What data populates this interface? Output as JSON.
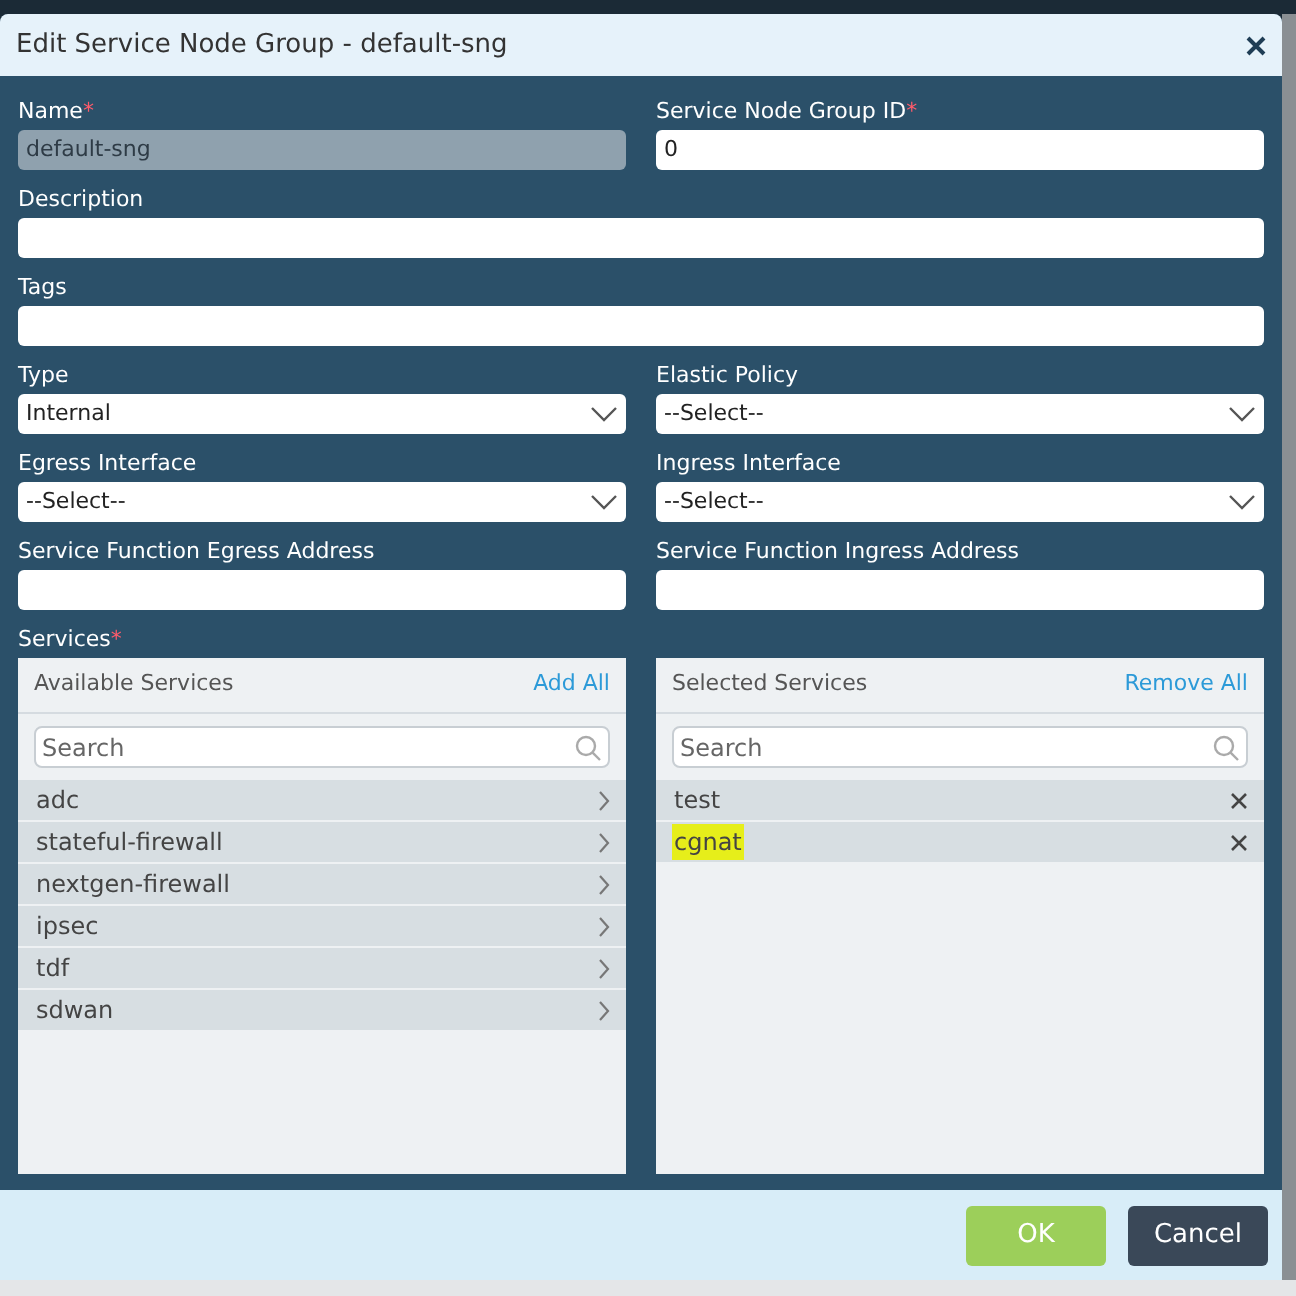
{
  "dialog": {
    "title": "Edit Service Node Group - default-sng"
  },
  "fields": [
    {
      "kind": "text",
      "label": "Name",
      "required_mark": "*",
      "value": "default-sng",
      "disabled": true,
      "wide": false
    },
    {
      "kind": "text",
      "label": "Service Node Group ID",
      "required_mark": "*",
      "value": "0",
      "disabled": false,
      "wide": false
    },
    {
      "kind": "text",
      "label": "Description",
      "disabled": false,
      "wide": true
    },
    {
      "kind": "text",
      "label": "Tags",
      "disabled": false,
      "wide": true
    },
    {
      "kind": "select",
      "label": "Type",
      "value": "Internal",
      "disabled": false,
      "wide": false
    },
    {
      "kind": "select",
      "label": "Elastic Policy",
      "value": "--Select--",
      "disabled": false,
      "wide": false
    },
    {
      "kind": "select",
      "label": "Egress Interface",
      "value": "--Select--",
      "disabled": false,
      "wide": false
    },
    {
      "kind": "select",
      "label": "Ingress Interface",
      "value": "--Select--",
      "disabled": false,
      "wide": false
    },
    {
      "kind": "text",
      "label": "Service Function Egress Address",
      "disabled": false,
      "wide": false
    },
    {
      "kind": "text",
      "label": "Service Function Ingress Address",
      "disabled": false,
      "wide": false
    }
  ],
  "services": {
    "label": "Services",
    "required_mark": "*",
    "available": {
      "title": "Available Services",
      "action": "Add All",
      "placeholder": "Search",
      "items": [
        {
          "name": "adc",
          "highlighted": false
        },
        {
          "name": "stateful-firewall",
          "highlighted": false
        },
        {
          "name": "nextgen-firewall",
          "highlighted": false
        },
        {
          "name": "ipsec",
          "highlighted": false
        },
        {
          "name": "tdf",
          "highlighted": false
        },
        {
          "name": "sdwan",
          "highlighted": false
        }
      ]
    },
    "selected": {
      "title": "Selected Services",
      "action": "Remove All",
      "placeholder": "Search",
      "items": [
        {
          "name": "test",
          "highlighted": false
        },
        {
          "name": "cgnat",
          "highlighted": true
        }
      ]
    }
  },
  "buttons": [
    {
      "label": "OK",
      "kind": "primary"
    },
    {
      "label": "Cancel",
      "kind": "secondary"
    }
  ]
}
